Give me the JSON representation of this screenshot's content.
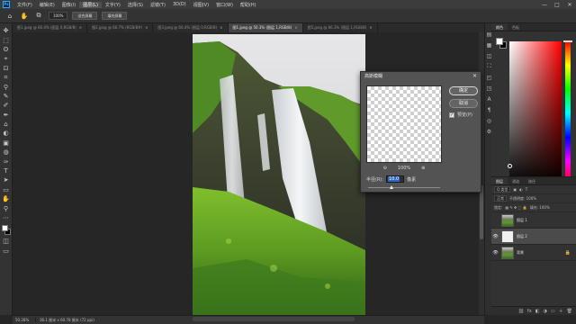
{
  "app": {
    "logo_text": "Ps"
  },
  "menu": {
    "items": [
      "文件(F)",
      "编辑(E)",
      "图像(I)",
      "图层(L)",
      "文字(Y)",
      "选择(S)",
      "滤镜(T)",
      "3D(D)",
      "视图(V)",
      "窗口(W)",
      "帮助(H)"
    ],
    "active_index": 3,
    "window_controls": [
      "—",
      "□",
      "✕"
    ]
  },
  "options": {
    "zoom_value": "100%",
    "fit_screen": "适合屏幕",
    "fill_screen": "填充屏幕"
  },
  "doc_tabs": [
    {
      "label": "图1.jpeg @ 66.4% (图层 0,RGB/8)",
      "close": "×"
    },
    {
      "label": "图2.jpeg @ 66.7% (RGB/8#)",
      "close": "×"
    },
    {
      "label": "图3.jpeg @ 66.4% (图层 0,RGB/8)",
      "close": "×"
    },
    {
      "label": "图1.jpeg @ 50.3% (图层 1,RGB/8)",
      "close": "×",
      "active": true
    },
    {
      "label": "图5.jpeg @ 66.3% (图层 1,RGB/8)",
      "close": "×"
    }
  ],
  "tools": [
    "✥",
    "⬚",
    "ʘ",
    "⌖",
    "⊡",
    "⌗",
    "⚲",
    "✎",
    "✐",
    "✒",
    "⌂",
    "◐",
    "▣",
    "◍",
    "✑",
    "T",
    "➤",
    "▭",
    "✋",
    "⚲",
    "⋯"
  ],
  "status": {
    "zoom": "50.28%",
    "info": "36.1 厘米 x 60.78 厘米 (72 ppi)"
  },
  "dialog": {
    "title": "高斯模糊",
    "close": "✕",
    "ok": "确定",
    "cancel": "取消",
    "preview_label": "预览(P)",
    "preview_checked": true,
    "zoom_out": "⊖",
    "zoom_level": "100%",
    "zoom_in": "⊕",
    "radius_label": "半径(R):",
    "radius_value": "10.0",
    "radius_unit": "像素",
    "slider_position": 0.33
  },
  "color_panel": {
    "tabs": [
      "颜色",
      "色板"
    ],
    "foreground": "#ffffff",
    "background": "#000000",
    "hue": "#ff0000"
  },
  "layers_panel": {
    "tabs": [
      "图层",
      "通道",
      "路径"
    ],
    "filter_label": "Q 类型",
    "blend_mode": "正常",
    "opacity_label": "不透明度: 100%",
    "lock_label": "锁定:",
    "fill_label": "填充: 100%",
    "layers": [
      {
        "name": "图层 1",
        "thumb": "photo",
        "visible": false,
        "selected": false,
        "locked": false
      },
      {
        "name": "图层 2",
        "thumb": "white",
        "visible": true,
        "selected": true,
        "locked": false
      },
      {
        "name": "背景",
        "thumb": "photo",
        "visible": true,
        "selected": false,
        "locked": true
      }
    ],
    "footer_icons": [
      "⛓",
      "fx",
      "◧",
      "◑",
      "▭",
      "＋",
      "🗑"
    ]
  },
  "right_strip_icons": [
    "◰",
    "◳",
    "A",
    "¶",
    "◎",
    "⚙"
  ],
  "left_strip_icons": [
    "▤",
    "▦",
    "◫",
    "⛶"
  ]
}
